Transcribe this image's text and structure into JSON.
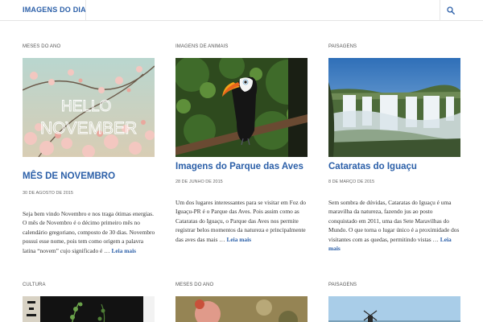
{
  "site": {
    "title": "IMAGENS DO DIA",
    "search_icon": "search-icon"
  },
  "posts": [
    {
      "category": "MESES DO ANO",
      "image_text": "Hello November",
      "title": "MÊS DE NOVEMBRO",
      "date": "30 DE AGOSTO DE 2015",
      "excerpt": "Seja bem vindo Novembro e nos traga ótimas energias. O mês de Novembro é o décimo primeiro mês no calendário gregoriano, composto de 30 dias. Novembro possui esse nome, pois tem como origem a palavra latina “novem” cujo significado é …",
      "read_more": "Leia mais"
    },
    {
      "category": "IMAGENS DE ANIMAIS",
      "title": "Imagens do Parque das Aves",
      "date": "28 DE JUNHO DE 2015",
      "excerpt": "Um dos lugares interessantes para se visitar em Foz do Iguaçu-PR é o Parque das Aves. Pois assim como as Cataratas do Iguaçu, o Parque das Aves nos permite registrar belos momentos da natureza e principalmente das aves das mais …",
      "read_more": "Leia mais"
    },
    {
      "category": "PAISAGENS",
      "title": "Cataratas do Iguaçu",
      "date": "8 DE MARÇO DE 2015",
      "excerpt": "Sem sombra de dúvidas, Cataratas do Iguaçu é uma maravilha da natureza, fazendo jus ao posto conquistado em 2011, uma das Sete Maravilhas do Mundo. O que torna o lugar único é a proximidade dos visitantes com as quedas, permitindo vistas …",
      "read_more": "Leia mais"
    }
  ],
  "row2": [
    {
      "category": "CULTURA"
    },
    {
      "category": "MESES DO ANO"
    },
    {
      "category": "PAISAGENS"
    }
  ],
  "colors": {
    "link": "#2b5fa8",
    "border": "#e4e4e4"
  }
}
